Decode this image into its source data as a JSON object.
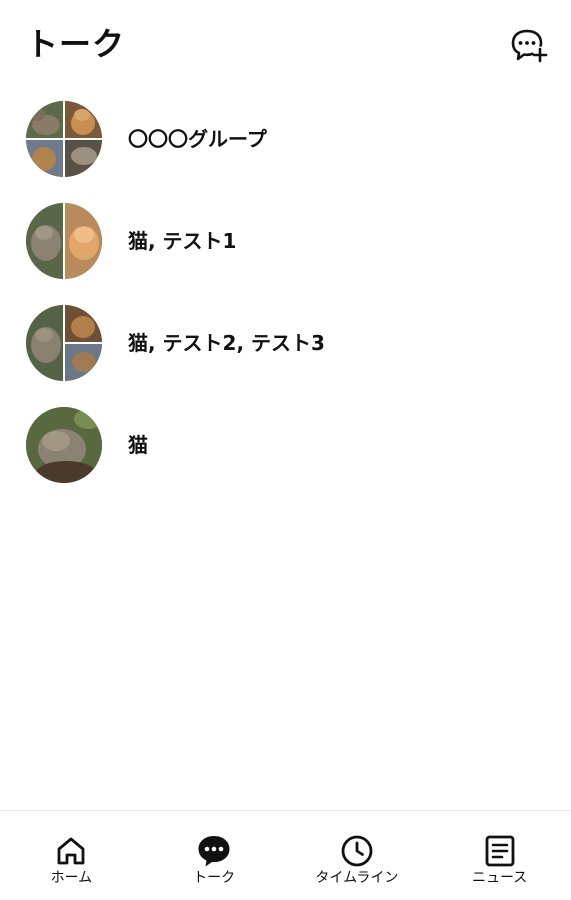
{
  "header": {
    "title": "トーク",
    "new_chat_icon": "chat-plus-icon"
  },
  "chats": [
    {
      "name": "〇〇〇グループ",
      "avatar": "four-cat-photo-collage"
    },
    {
      "name": "猫, テスト1",
      "avatar": "two-cat-photo-split"
    },
    {
      "name": "猫, テスト2, テスト3",
      "avatar": "three-cat-photo-collage"
    },
    {
      "name": "猫",
      "avatar": "single-cat-photo"
    }
  ],
  "tabbar": {
    "active_tab": "トーク",
    "tabs": [
      {
        "label": "ホーム",
        "icon": "home-icon"
      },
      {
        "label": "トーク",
        "icon": "chat-bubble-icon"
      },
      {
        "label": "タイムライン",
        "icon": "clock-icon"
      },
      {
        "label": "ニュース",
        "icon": "news-icon"
      }
    ]
  },
  "colors": {
    "background": "#ffffff",
    "text": "#111111",
    "divider": "#ececec"
  }
}
